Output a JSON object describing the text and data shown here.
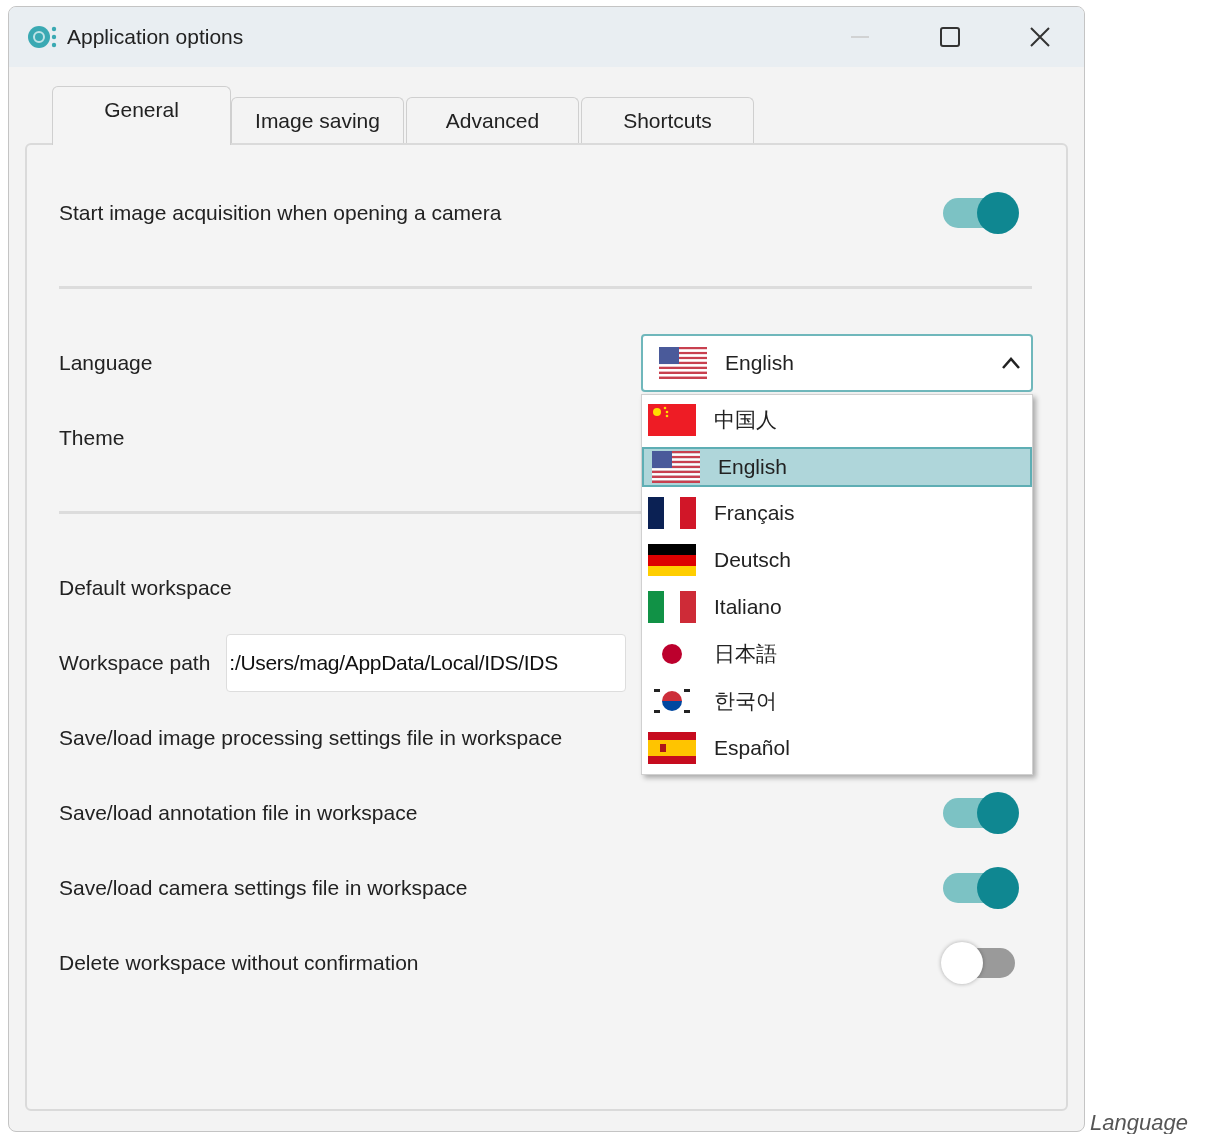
{
  "window": {
    "title": "Application options",
    "controls": [
      {
        "kind": "minimize",
        "disabled": true
      },
      {
        "kind": "maximize",
        "disabled": false
      },
      {
        "kind": "close",
        "disabled": false
      }
    ]
  },
  "tabs": [
    {
      "label": "General",
      "selected": true
    },
    {
      "label": "Image saving",
      "selected": false
    },
    {
      "label": "Advanced",
      "selected": false
    },
    {
      "label": "Shortcuts",
      "selected": false
    }
  ],
  "settings": [
    {
      "kind": "toggle",
      "label": "Start image acquisition when opening a camera",
      "on": true
    },
    {
      "kind": "divider"
    },
    {
      "kind": "select",
      "label": "Language",
      "value": "English",
      "expanded": true,
      "options": [
        {
          "label": "中国人",
          "kind": "cn",
          "selected": false
        },
        {
          "label": "English",
          "kind": "us",
          "selected": true
        },
        {
          "label": "Français",
          "kind": "fr",
          "selected": false
        },
        {
          "label": "Deutsch",
          "kind": "de",
          "selected": false
        },
        {
          "label": "Italiano",
          "kind": "it",
          "selected": false
        },
        {
          "label": "日本語",
          "kind": "jp",
          "selected": false
        },
        {
          "label": "한국어",
          "kind": "kr",
          "selected": false
        },
        {
          "label": "Español",
          "kind": "es",
          "selected": false
        }
      ]
    },
    {
      "kind": "label",
      "label": "Theme"
    },
    {
      "kind": "divider"
    },
    {
      "kind": "label",
      "label": "Default workspace"
    },
    {
      "kind": "input",
      "label": "Workspace path",
      "value": ":/Users/mag/AppData/Local/IDS/IDS"
    },
    {
      "kind": "label",
      "label": "Save/load image processing settings file in workspace"
    },
    {
      "kind": "toggle",
      "label": "Save/load annotation file in workspace",
      "on": true
    },
    {
      "kind": "toggle",
      "label": "Save/load camera settings file in workspace",
      "on": true
    },
    {
      "kind": "toggle",
      "label": "Delete workspace without confirmation",
      "on": false
    }
  ],
  "caption": "Language"
}
